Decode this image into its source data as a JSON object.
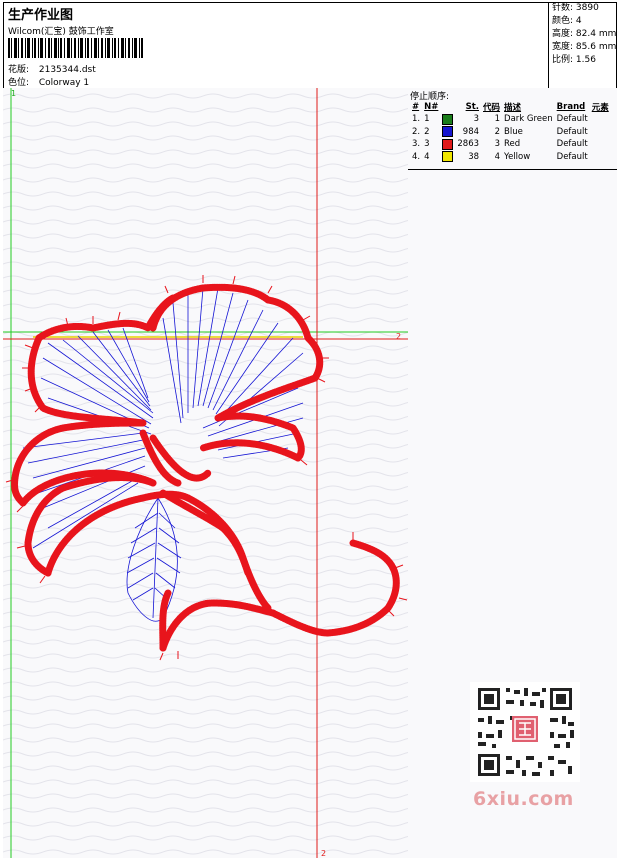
{
  "header": {
    "title": "生产作业图",
    "subtitle": "Wilcom(汇宝) 鼓饰工作室",
    "file_label": "花版:",
    "file_value": "2135344.dst",
    "colorway_label": "色位:",
    "colorway_value": "Colorway 1"
  },
  "stats": [
    {
      "label": "针数:",
      "value": "3890"
    },
    {
      "label": "颜色:",
      "value": "4"
    },
    {
      "label": "高度:",
      "value": "82.4 mm"
    },
    {
      "label": "宽度:",
      "value": "85.6 mm"
    },
    {
      "label": "比例:",
      "value": "1.56"
    }
  ],
  "stop_sequence": {
    "title": "停止顺序:",
    "headers": [
      "#",
      "N#",
      "",
      "St.",
      "代码",
      "描述",
      "Brand",
      "元素"
    ],
    "rows": [
      {
        "idx": "1.",
        "n": "1",
        "color": "#1a7d1a",
        "st": "3",
        "code": "1",
        "desc": "Dark Green",
        "brand": "Default"
      },
      {
        "idx": "2.",
        "n": "2",
        "color": "#1515d0",
        "st": "984",
        "code": "2",
        "desc": "Blue",
        "brand": "Default"
      },
      {
        "idx": "3.",
        "n": "3",
        "color": "#e01a1a",
        "st": "2863",
        "code": "3",
        "desc": "Red",
        "brand": "Default"
      },
      {
        "idx": "4.",
        "n": "4",
        "color": "#f0e600",
        "st": "38",
        "code": "4",
        "desc": "Yellow",
        "brand": "Default"
      }
    ]
  },
  "canvas_marks": {
    "corner_1": "1",
    "guide_2_right": "2",
    "guide_2_bottom": "2"
  },
  "watermark": "6xiu.com",
  "colors": {
    "stitch_red": "#e8141c",
    "stitch_blue": "#1414d4",
    "guide_green": "#22cc22",
    "guide_red": "#e01a1a"
  }
}
